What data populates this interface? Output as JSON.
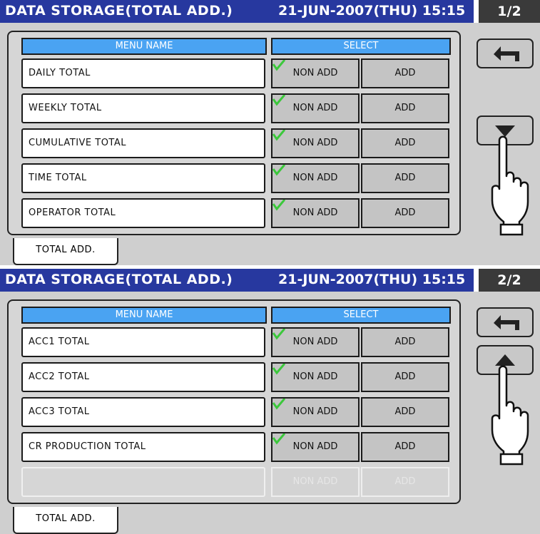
{
  "colors": {
    "title_bar": "#27389f",
    "header": "#4aa3f2",
    "check": "#3cc83c",
    "background": "#cfcfcf"
  },
  "panels": [
    {
      "title": "DATA STORAGE(TOTAL ADD.)",
      "datetime": "21-JUN-2007(THU)  15:15",
      "page": "1/2",
      "columns": {
        "name": "MENU NAME",
        "select": "SELECT"
      },
      "rows": [
        {
          "name": "DAILY TOTAL",
          "non_add": "NON ADD",
          "add": "ADD",
          "selected": "NON ADD"
        },
        {
          "name": "WEEKLY TOTAL",
          "non_add": "NON ADD",
          "add": "ADD",
          "selected": "NON ADD"
        },
        {
          "name": "CUMULATIVE TOTAL",
          "non_add": "NON ADD",
          "add": "ADD",
          "selected": "NON ADD"
        },
        {
          "name": "TIME TOTAL",
          "non_add": "NON ADD",
          "add": "ADD",
          "selected": "NON ADD"
        },
        {
          "name": "OPERATOR TOTAL",
          "non_add": "NON ADD",
          "add": "ADD",
          "selected": "NON ADD"
        }
      ],
      "tab": "TOTAL ADD.",
      "side_buttons": [
        "back-arrow-icon",
        "down-arrow-icon"
      ]
    },
    {
      "title": "DATA STORAGE(TOTAL ADD.)",
      "datetime": "21-JUN-2007(THU)  15:15",
      "page": "2/2",
      "columns": {
        "name": "MENU NAME",
        "select": "SELECT"
      },
      "rows": [
        {
          "name": "ACC1 TOTAL",
          "non_add": "NON ADD",
          "add": "ADD",
          "selected": "NON ADD"
        },
        {
          "name": "ACC2 TOTAL",
          "non_add": "NON ADD",
          "add": "ADD",
          "selected": "NON ADD"
        },
        {
          "name": "ACC3 TOTAL",
          "non_add": "NON ADD",
          "add": "ADD",
          "selected": "NON ADD"
        },
        {
          "name": "CR PRODUCTION TOTAL",
          "non_add": "NON ADD",
          "add": "ADD",
          "selected": "NON ADD"
        },
        {
          "name": "",
          "non_add": "NON ADD",
          "add": "ADD",
          "selected": "",
          "disabled": true
        }
      ],
      "tab": "TOTAL ADD.",
      "side_buttons": [
        "back-arrow-icon",
        "up-arrow-icon"
      ]
    }
  ]
}
